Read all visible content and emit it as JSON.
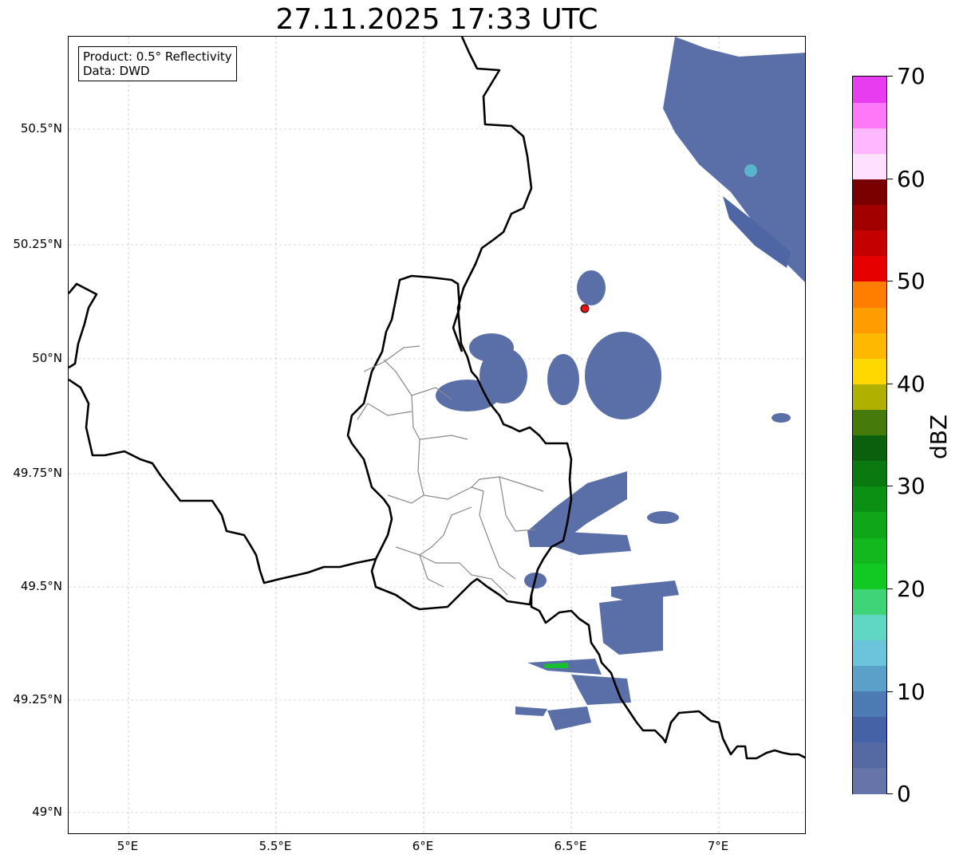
{
  "title": "27.11.2025 17:33 UTC",
  "info_box": {
    "product": "Product: 0.5° Reflectivity",
    "data": "Data: DWD"
  },
  "latitude_ticks": [
    "50.5°N",
    "50.25°N",
    "50°N",
    "49.75°N",
    "49.5°N",
    "49.25°N",
    "49°N"
  ],
  "longitude_ticks": [
    "5°E",
    "5.5°E",
    "6°E",
    "6.5°E",
    "7°E"
  ],
  "colorbar": {
    "label": "dBZ",
    "ticks": [
      "0",
      "10",
      "20",
      "30",
      "40",
      "50",
      "60",
      "70"
    ],
    "colors": [
      "#6674aa",
      "#556aa2",
      "#4462a5",
      "#4b7bb2",
      "#5ba0c8",
      "#6bc4dc",
      "#60d6c4",
      "#40d478",
      "#12c822",
      "#13b81f",
      "#10a61a",
      "#0c9014",
      "#0a7a10",
      "#0a600c",
      "#467a0a",
      "#b0b000",
      "#ffd800",
      "#ffb800",
      "#ff9c00",
      "#ff7e00",
      "#e60000",
      "#c40000",
      "#a20000",
      "#7a0000",
      "#ffe0ff",
      "#ffb8ff",
      "#ff78f8",
      "#e83cf0"
    ]
  },
  "radar_site_marker_color": "#ee1111"
}
